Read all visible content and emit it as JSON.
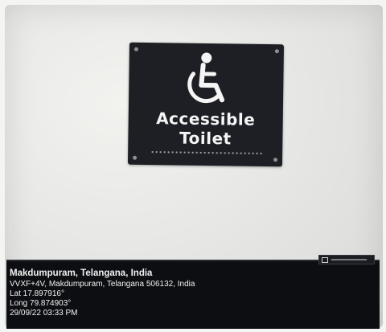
{
  "sign": {
    "line1": "Accessible",
    "line2": "Toilet",
    "symbol": "wheelchair-icon",
    "background_color": "#1d1f24",
    "text_color": "#f5f5f5"
  },
  "geotag": {
    "place": "Makdumpuram, Telangana, India",
    "address": "VVXF+4V, Makdumpuram, Telangana 506132, India",
    "latitude": "Lat 17.897916°",
    "longitude": "Long 79.874903°",
    "datetime": "29/09/22 03:33 PM",
    "stamp_icon": "gps-map-camera-icon"
  }
}
